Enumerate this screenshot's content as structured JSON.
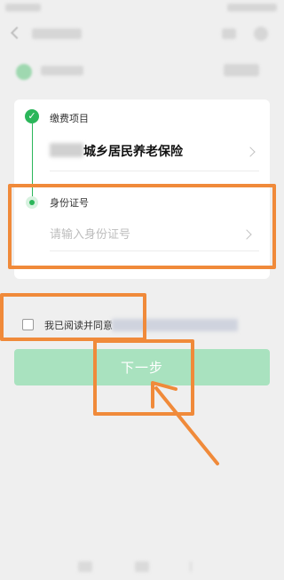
{
  "form": {
    "step1": {
      "label": "缴费项目",
      "value": "城乡居民养老保险"
    },
    "step2": {
      "label": "身份证号",
      "placeholder": "请输入身份证号"
    }
  },
  "agreement": {
    "text": "我已阅读并同意"
  },
  "next_button": {
    "label": "下一步"
  },
  "colors": {
    "accent_green": "#2bb65a",
    "button_disabled_green": "#a9e2bf",
    "annotation_orange": "#f08a3a",
    "background": "#efefef"
  },
  "icons": [
    "check-icon",
    "chevron-right-icon",
    "back-icon"
  ]
}
